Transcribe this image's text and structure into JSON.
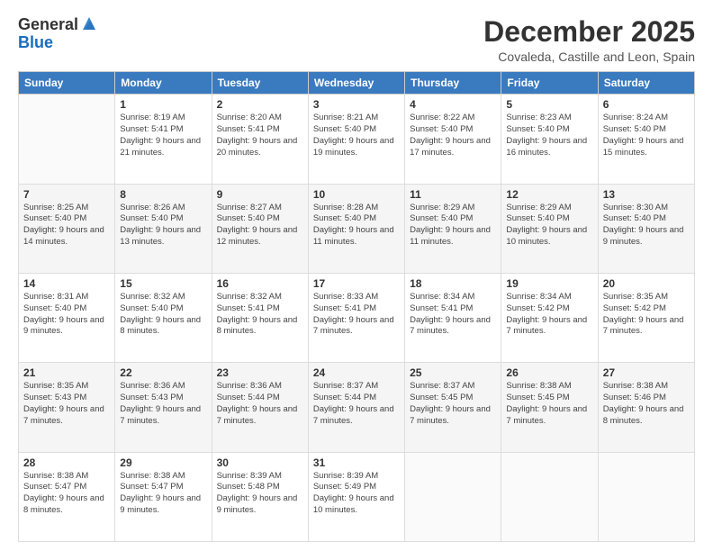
{
  "header": {
    "logo_general": "General",
    "logo_blue": "Blue",
    "month_title": "December 2025",
    "location": "Covaleda, Castille and Leon, Spain"
  },
  "days_of_week": [
    "Sunday",
    "Monday",
    "Tuesday",
    "Wednesday",
    "Thursday",
    "Friday",
    "Saturday"
  ],
  "weeks": [
    [
      {
        "day": "",
        "sunrise": "",
        "sunset": "",
        "daylight": ""
      },
      {
        "day": "1",
        "sunrise": "Sunrise: 8:19 AM",
        "sunset": "Sunset: 5:41 PM",
        "daylight": "Daylight: 9 hours and 21 minutes."
      },
      {
        "day": "2",
        "sunrise": "Sunrise: 8:20 AM",
        "sunset": "Sunset: 5:41 PM",
        "daylight": "Daylight: 9 hours and 20 minutes."
      },
      {
        "day": "3",
        "sunrise": "Sunrise: 8:21 AM",
        "sunset": "Sunset: 5:40 PM",
        "daylight": "Daylight: 9 hours and 19 minutes."
      },
      {
        "day": "4",
        "sunrise": "Sunrise: 8:22 AM",
        "sunset": "Sunset: 5:40 PM",
        "daylight": "Daylight: 9 hours and 17 minutes."
      },
      {
        "day": "5",
        "sunrise": "Sunrise: 8:23 AM",
        "sunset": "Sunset: 5:40 PM",
        "daylight": "Daylight: 9 hours and 16 minutes."
      },
      {
        "day": "6",
        "sunrise": "Sunrise: 8:24 AM",
        "sunset": "Sunset: 5:40 PM",
        "daylight": "Daylight: 9 hours and 15 minutes."
      }
    ],
    [
      {
        "day": "7",
        "sunrise": "Sunrise: 8:25 AM",
        "sunset": "Sunset: 5:40 PM",
        "daylight": "Daylight: 9 hours and 14 minutes."
      },
      {
        "day": "8",
        "sunrise": "Sunrise: 8:26 AM",
        "sunset": "Sunset: 5:40 PM",
        "daylight": "Daylight: 9 hours and 13 minutes."
      },
      {
        "day": "9",
        "sunrise": "Sunrise: 8:27 AM",
        "sunset": "Sunset: 5:40 PM",
        "daylight": "Daylight: 9 hours and 12 minutes."
      },
      {
        "day": "10",
        "sunrise": "Sunrise: 8:28 AM",
        "sunset": "Sunset: 5:40 PM",
        "daylight": "Daylight: 9 hours and 11 minutes."
      },
      {
        "day": "11",
        "sunrise": "Sunrise: 8:29 AM",
        "sunset": "Sunset: 5:40 PM",
        "daylight": "Daylight: 9 hours and 11 minutes."
      },
      {
        "day": "12",
        "sunrise": "Sunrise: 8:29 AM",
        "sunset": "Sunset: 5:40 PM",
        "daylight": "Daylight: 9 hours and 10 minutes."
      },
      {
        "day": "13",
        "sunrise": "Sunrise: 8:30 AM",
        "sunset": "Sunset: 5:40 PM",
        "daylight": "Daylight: 9 hours and 9 minutes."
      }
    ],
    [
      {
        "day": "14",
        "sunrise": "Sunrise: 8:31 AM",
        "sunset": "Sunset: 5:40 PM",
        "daylight": "Daylight: 9 hours and 9 minutes."
      },
      {
        "day": "15",
        "sunrise": "Sunrise: 8:32 AM",
        "sunset": "Sunset: 5:40 PM",
        "daylight": "Daylight: 9 hours and 8 minutes."
      },
      {
        "day": "16",
        "sunrise": "Sunrise: 8:32 AM",
        "sunset": "Sunset: 5:41 PM",
        "daylight": "Daylight: 9 hours and 8 minutes."
      },
      {
        "day": "17",
        "sunrise": "Sunrise: 8:33 AM",
        "sunset": "Sunset: 5:41 PM",
        "daylight": "Daylight: 9 hours and 7 minutes."
      },
      {
        "day": "18",
        "sunrise": "Sunrise: 8:34 AM",
        "sunset": "Sunset: 5:41 PM",
        "daylight": "Daylight: 9 hours and 7 minutes."
      },
      {
        "day": "19",
        "sunrise": "Sunrise: 8:34 AM",
        "sunset": "Sunset: 5:42 PM",
        "daylight": "Daylight: 9 hours and 7 minutes."
      },
      {
        "day": "20",
        "sunrise": "Sunrise: 8:35 AM",
        "sunset": "Sunset: 5:42 PM",
        "daylight": "Daylight: 9 hours and 7 minutes."
      }
    ],
    [
      {
        "day": "21",
        "sunrise": "Sunrise: 8:35 AM",
        "sunset": "Sunset: 5:43 PM",
        "daylight": "Daylight: 9 hours and 7 minutes."
      },
      {
        "day": "22",
        "sunrise": "Sunrise: 8:36 AM",
        "sunset": "Sunset: 5:43 PM",
        "daylight": "Daylight: 9 hours and 7 minutes."
      },
      {
        "day": "23",
        "sunrise": "Sunrise: 8:36 AM",
        "sunset": "Sunset: 5:44 PM",
        "daylight": "Daylight: 9 hours and 7 minutes."
      },
      {
        "day": "24",
        "sunrise": "Sunrise: 8:37 AM",
        "sunset": "Sunset: 5:44 PM",
        "daylight": "Daylight: 9 hours and 7 minutes."
      },
      {
        "day": "25",
        "sunrise": "Sunrise: 8:37 AM",
        "sunset": "Sunset: 5:45 PM",
        "daylight": "Daylight: 9 hours and 7 minutes."
      },
      {
        "day": "26",
        "sunrise": "Sunrise: 8:38 AM",
        "sunset": "Sunset: 5:45 PM",
        "daylight": "Daylight: 9 hours and 7 minutes."
      },
      {
        "day": "27",
        "sunrise": "Sunrise: 8:38 AM",
        "sunset": "Sunset: 5:46 PM",
        "daylight": "Daylight: 9 hours and 8 minutes."
      }
    ],
    [
      {
        "day": "28",
        "sunrise": "Sunrise: 8:38 AM",
        "sunset": "Sunset: 5:47 PM",
        "daylight": "Daylight: 9 hours and 8 minutes."
      },
      {
        "day": "29",
        "sunrise": "Sunrise: 8:38 AM",
        "sunset": "Sunset: 5:47 PM",
        "daylight": "Daylight: 9 hours and 9 minutes."
      },
      {
        "day": "30",
        "sunrise": "Sunrise: 8:39 AM",
        "sunset": "Sunset: 5:48 PM",
        "daylight": "Daylight: 9 hours and 9 minutes."
      },
      {
        "day": "31",
        "sunrise": "Sunrise: 8:39 AM",
        "sunset": "Sunset: 5:49 PM",
        "daylight": "Daylight: 9 hours and 10 minutes."
      },
      {
        "day": "",
        "sunrise": "",
        "sunset": "",
        "daylight": ""
      },
      {
        "day": "",
        "sunrise": "",
        "sunset": "",
        "daylight": ""
      },
      {
        "day": "",
        "sunrise": "",
        "sunset": "",
        "daylight": ""
      }
    ]
  ]
}
